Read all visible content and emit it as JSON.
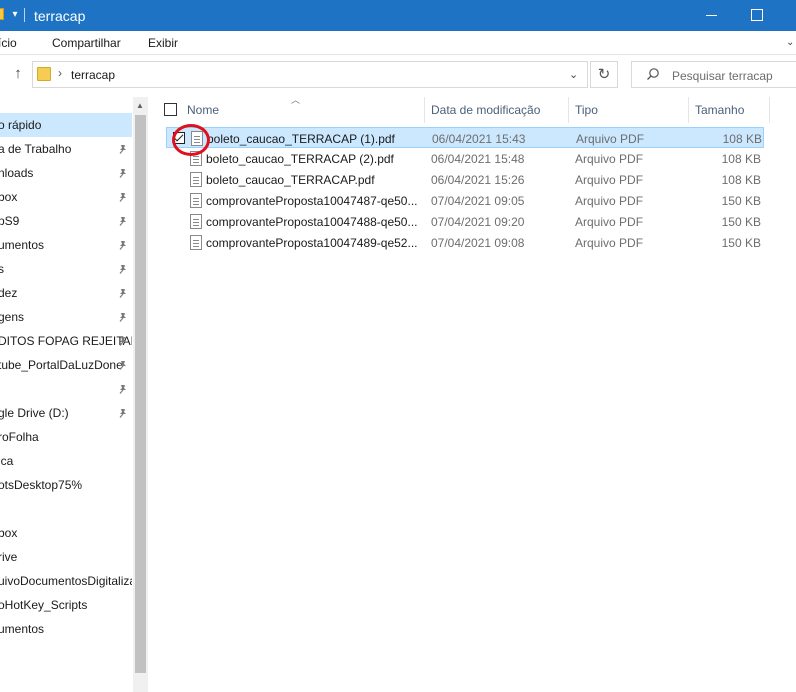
{
  "window": {
    "title": "terracap",
    "dropdown_glyph": "▾",
    "min_icon": "minimize-icon",
    "max_icon": "maximize-icon"
  },
  "ribbon": {
    "tabs": [
      {
        "label": "ício"
      },
      {
        "label": "Compartilhar"
      },
      {
        "label": "Exibir"
      }
    ]
  },
  "address": {
    "path": "terracap",
    "separator": "›",
    "search_placeholder": "Pesquisar terracap"
  },
  "sidebar": {
    "items": [
      {
        "label": "o rápido",
        "pinned": false,
        "selected": true
      },
      {
        "label": "a de Trabalho",
        "pinned": true
      },
      {
        "label": "nloads",
        "pinned": true
      },
      {
        "label": "box",
        "pinned": true
      },
      {
        "label": "pS9",
        "pinned": true
      },
      {
        "label": "umentos",
        "pinned": true
      },
      {
        "label": "s",
        "pinned": true
      },
      {
        "label": "dez",
        "pinned": true
      },
      {
        "label": "gens",
        "pinned": true
      },
      {
        "label": "DITOS FOPAG REJEITAD",
        "pinned": true
      },
      {
        "label": "tube_PortalDaLuzDone",
        "pinned": true
      },
      {
        "label": "",
        "pinned": true
      },
      {
        "label": "gle Drive (D:)",
        "pinned": true
      },
      {
        "label": "roFolha",
        "pinned": false
      },
      {
        "label": "ica",
        "pinned": false
      },
      {
        "label": "otsDesktop75%",
        "pinned": false
      },
      {
        "label": "",
        "pinned": false
      },
      {
        "label": "box",
        "pinned": false
      },
      {
        "label": "rive",
        "pinned": false
      },
      {
        "label": "uivoDocumentosDigitaliza",
        "pinned": false
      },
      {
        "label": "oHotKey_Scripts",
        "pinned": false
      },
      {
        "label": "umentos",
        "pinned": false
      }
    ]
  },
  "columns": {
    "name": "Nome",
    "date": "Data de modificação",
    "type": "Tipo",
    "size": "Tamanho"
  },
  "files": [
    {
      "name": "boleto_caucao_TERRACAP (1).pdf",
      "date": "06/04/2021 15:43",
      "type": "Arquivo PDF",
      "size": "108 KB",
      "selected": true
    },
    {
      "name": "boleto_caucao_TERRACAP (2).pdf",
      "date": "06/04/2021 15:48",
      "type": "Arquivo PDF",
      "size": "108 KB"
    },
    {
      "name": "boleto_caucao_TERRACAP.pdf",
      "date": "06/04/2021 15:26",
      "type": "Arquivo PDF",
      "size": "108 KB"
    },
    {
      "name": "comprovanteProposta10047487-qe50...",
      "date": "07/04/2021 09:05",
      "type": "Arquivo PDF",
      "size": "150 KB"
    },
    {
      "name": "comprovanteProposta10047488-qe50...",
      "date": "07/04/2021 09:20",
      "type": "Arquivo PDF",
      "size": "150 KB"
    },
    {
      "name": "comprovanteProposta10047489-qe52...",
      "date": "07/04/2021 09:08",
      "type": "Arquivo PDF",
      "size": "150 KB"
    }
  ],
  "colors": {
    "titlebar": "#1e73c4",
    "selection": "#cce8ff",
    "annotation": "#e0101c"
  }
}
